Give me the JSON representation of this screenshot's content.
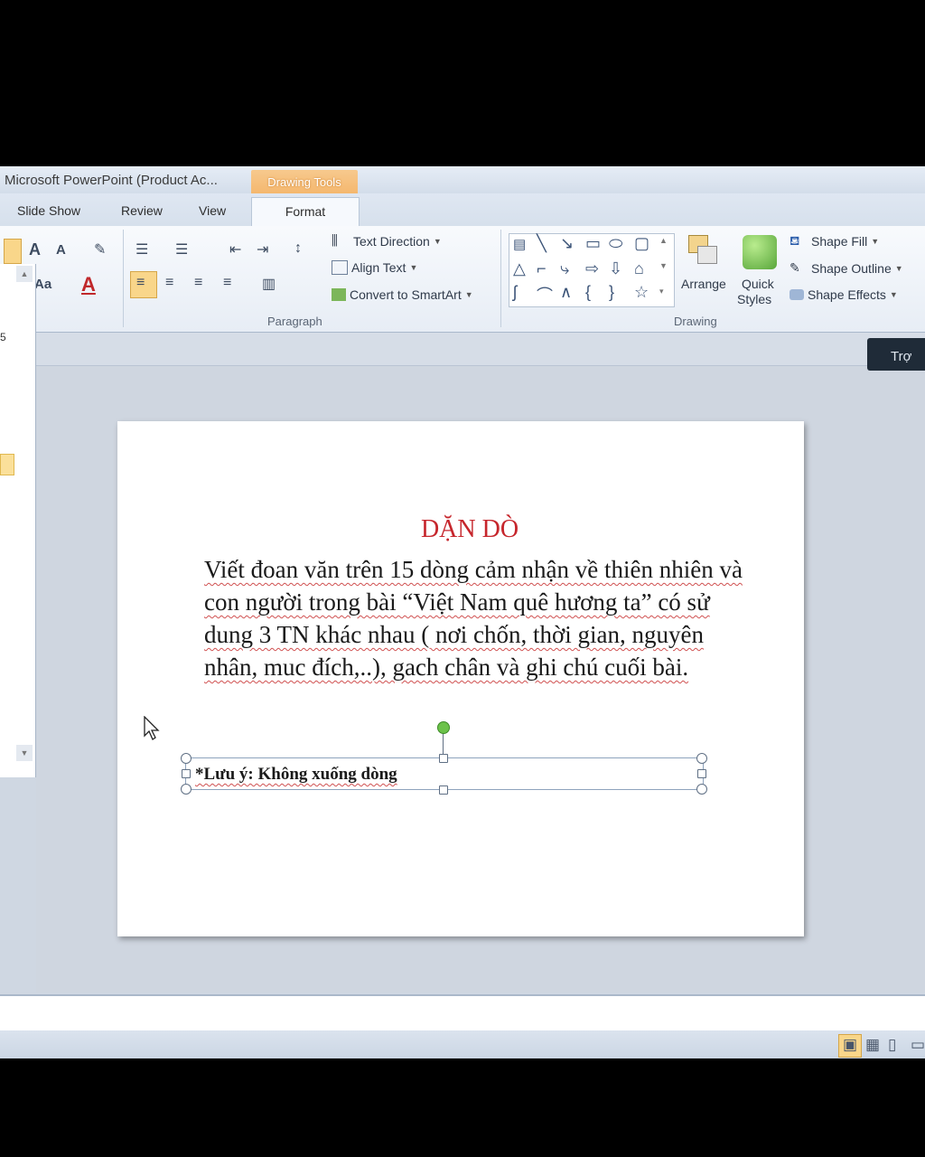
{
  "window": {
    "title": "Microsoft PowerPoint (Product Ac...",
    "context_tab": "Drawing Tools"
  },
  "tabs": [
    "Slide Show",
    "Review",
    "View",
    "Format"
  ],
  "ribbon": {
    "paragraph": {
      "label": "Paragraph",
      "text_direction": "Text Direction",
      "align_text": "Align Text",
      "convert_smartart": "Convert to SmartArt"
    },
    "drawing": {
      "label": "Drawing",
      "arrange": "Arrange",
      "quick_styles_1": "Quick",
      "quick_styles_2": "Styles",
      "shape_fill": "Shape Fill",
      "shape_outline": "Shape Outline",
      "shape_effects": "Shape Effects"
    }
  },
  "help_button": "Trợ",
  "slide": {
    "heading": "DẶN DÒ",
    "body": "Viết đoan văn trên 15 dòng cảm nhận về thiên nhiên và con người trong bài “Việt Nam quê hương ta” có sử dung 3 TN khác nhau ( nơi chốn, thời gian, nguyên nhân, muc đích,..), gach chân và ghi chú cuối bài.",
    "note": "*Lưu ý: Không xuống dòng"
  },
  "left_panel_number": "5",
  "colors": {
    "heading": "#c6262c",
    "context_tab": "#f4b56a",
    "selection_handle": "#6cc24a"
  }
}
